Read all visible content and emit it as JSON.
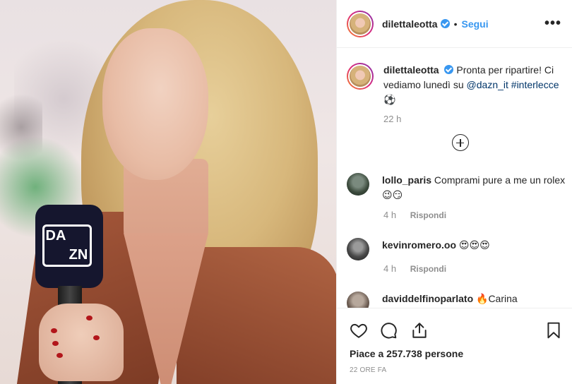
{
  "header": {
    "username": "dilettaleotta",
    "separator": "•",
    "follow_label": "Segui",
    "more_label": "•••"
  },
  "photo": {
    "mic_logo": [
      "DA",
      "ZN"
    ]
  },
  "caption": {
    "username": "dilettaleotta",
    "text": "Pronta per ripartire! Ci vediamo lunedì su ",
    "mention": "@dazn_it",
    "hashtag": "#interlecce",
    "emoji": "⚽",
    "time": "22 h"
  },
  "comments": [
    {
      "username": "lollo_paris",
      "text": "Comprami pure a me un rolex😉😏",
      "time": "4 h",
      "reply_label": "Rispondi"
    },
    {
      "username": "kevinromero.oo",
      "text": "😍😍😍",
      "time": "4 h",
      "reply_label": "Rispondi"
    },
    {
      "username": "daviddelfinoparlato",
      "text": "🔥Carina"
    }
  ],
  "actions": {
    "likes": "Piace a 257.738 persone",
    "timestamp": "22 ORE FA"
  },
  "colors": {
    "accent": "#3897f0",
    "text": "#262626",
    "muted": "#8e8e8e"
  }
}
